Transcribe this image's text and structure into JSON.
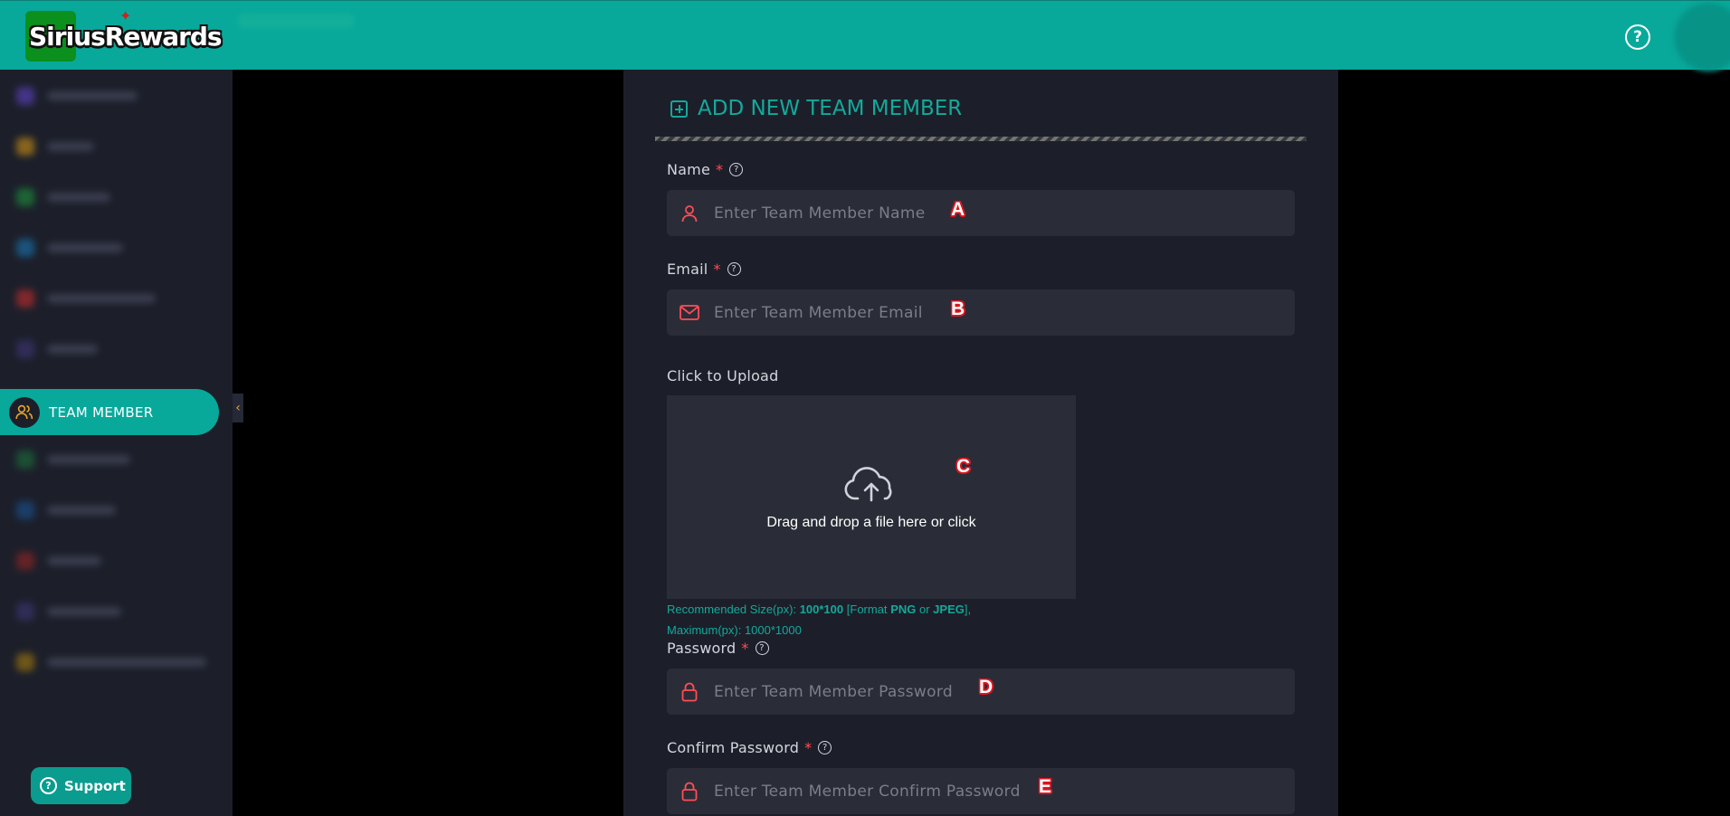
{
  "header": {
    "logo_text": "SiriusRewards",
    "help_icon": "help-circle-icon"
  },
  "sidebar": {
    "active_item": {
      "label": "TEAM MEMBER",
      "icon": "users-icon"
    },
    "support_label": "Support"
  },
  "form": {
    "title": "ADD NEW TEAM MEMBER",
    "name": {
      "label": "Name",
      "required": "*",
      "placeholder": "Enter Team Member Name",
      "marker": "A"
    },
    "email": {
      "label": "Email",
      "required": "*",
      "placeholder": "Enter Team Member Email",
      "marker": "B"
    },
    "upload": {
      "label": "Click to Upload",
      "drop_text": "Drag and drop a file here or click",
      "marker": "C",
      "hint_prefix": "Recommended Size(px):",
      "hint_size": "100*100",
      "hint_format_prefix": "[Format",
      "hint_png": "PNG",
      "hint_or": "or",
      "hint_jpeg": "JPEG",
      "hint_suffix": "],",
      "hint_max": "Maximum(px): 1000*1000"
    },
    "password": {
      "label": "Password",
      "required": "*",
      "placeholder": "Enter Team Member Password",
      "marker": "D"
    },
    "confirm_password": {
      "label": "Confirm Password",
      "required": "*",
      "placeholder": "Enter Team Member Confirm Password",
      "marker": "E"
    }
  },
  "colors": {
    "accent": "#08a99b",
    "required": "#ff4d57",
    "panel": "#1c1f2a",
    "input": "#2a2d37"
  }
}
